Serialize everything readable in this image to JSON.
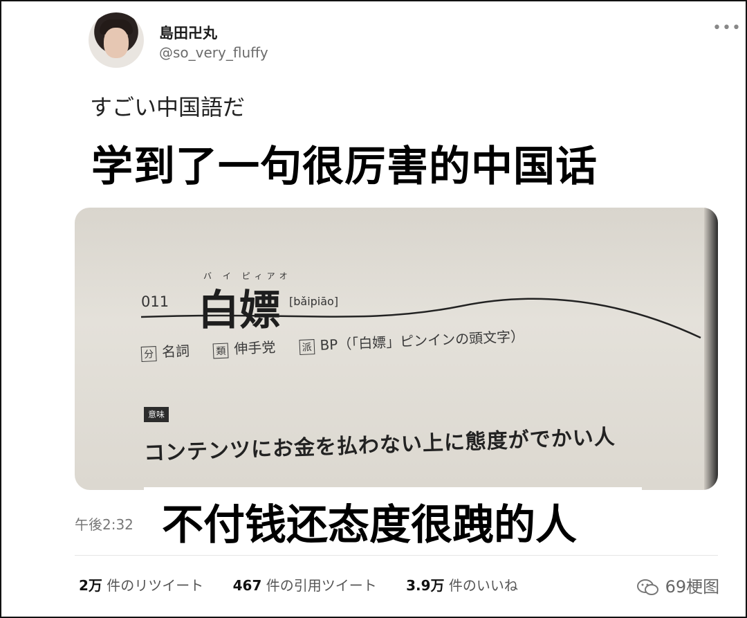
{
  "user": {
    "name": "島田卍丸",
    "handle": "@so_very_fluffy"
  },
  "tweet": {
    "text": "すごい中国語だ",
    "time": "午後2:32"
  },
  "overlays": {
    "caption_top": "学到了一句很厉害的中国话",
    "caption_bottom": "不付钱还态度很跩的人"
  },
  "book_page": {
    "page_number": "011",
    "word": "白嫖",
    "ruby": "バ イ ピィアオ",
    "pinyin": "[bǎipiāo]",
    "tag_1": "分",
    "pos": "名詞",
    "tag_2": "類",
    "related": "伸手党",
    "tag_3": "派",
    "derived": "BP（「白嫖」ピンインの頭文字）",
    "meaning_tag": "意味",
    "meaning": "コンテンツにお金を払わない上に態度がでかい人"
  },
  "stats": {
    "retweets_count": "2万",
    "retweets_label": "件のリツイート",
    "quotes_count": "467",
    "quotes_label": "件の引用ツイート",
    "likes_count": "3.9万",
    "likes_label": "件のいいね"
  },
  "watermark": {
    "text": "69梗图",
    "icon": "wechat-icon"
  },
  "more_icon": "more-dots-icon"
}
